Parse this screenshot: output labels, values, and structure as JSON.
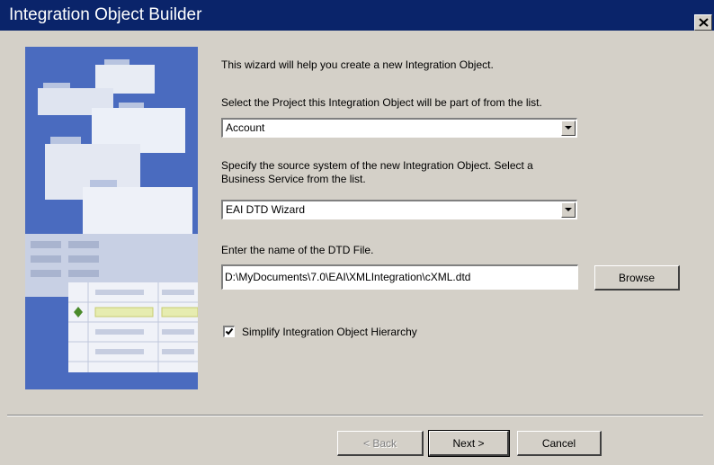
{
  "window": {
    "title": "Integration Object Builder",
    "close_icon": "close-icon"
  },
  "intro": "This wizard will help you create a new Integration Object.",
  "project": {
    "label": "Select the Project this Integration Object will be part of from the list.",
    "value": "Account"
  },
  "source": {
    "label_line1": "Specify the source system of the new Integration Object. Select a",
    "label_line2": "Business Service from the list.",
    "value": "EAI DTD Wizard"
  },
  "dtd": {
    "label": "Enter the name of the DTD File.",
    "value": "D:\\MyDocuments\\7.0\\EAI\\XMLIntegration\\cXML.dtd",
    "browse_label": "Browse"
  },
  "simplify": {
    "label": "Simplify Integration Object Hierarchy",
    "checked": true
  },
  "buttons": {
    "back": "< Back",
    "next": "Next >",
    "cancel": "Cancel"
  },
  "colors": {
    "titlebar": "#0a246a",
    "dialog_bg": "#d4d0c8",
    "illustration_bg": "#4a6bbf"
  }
}
